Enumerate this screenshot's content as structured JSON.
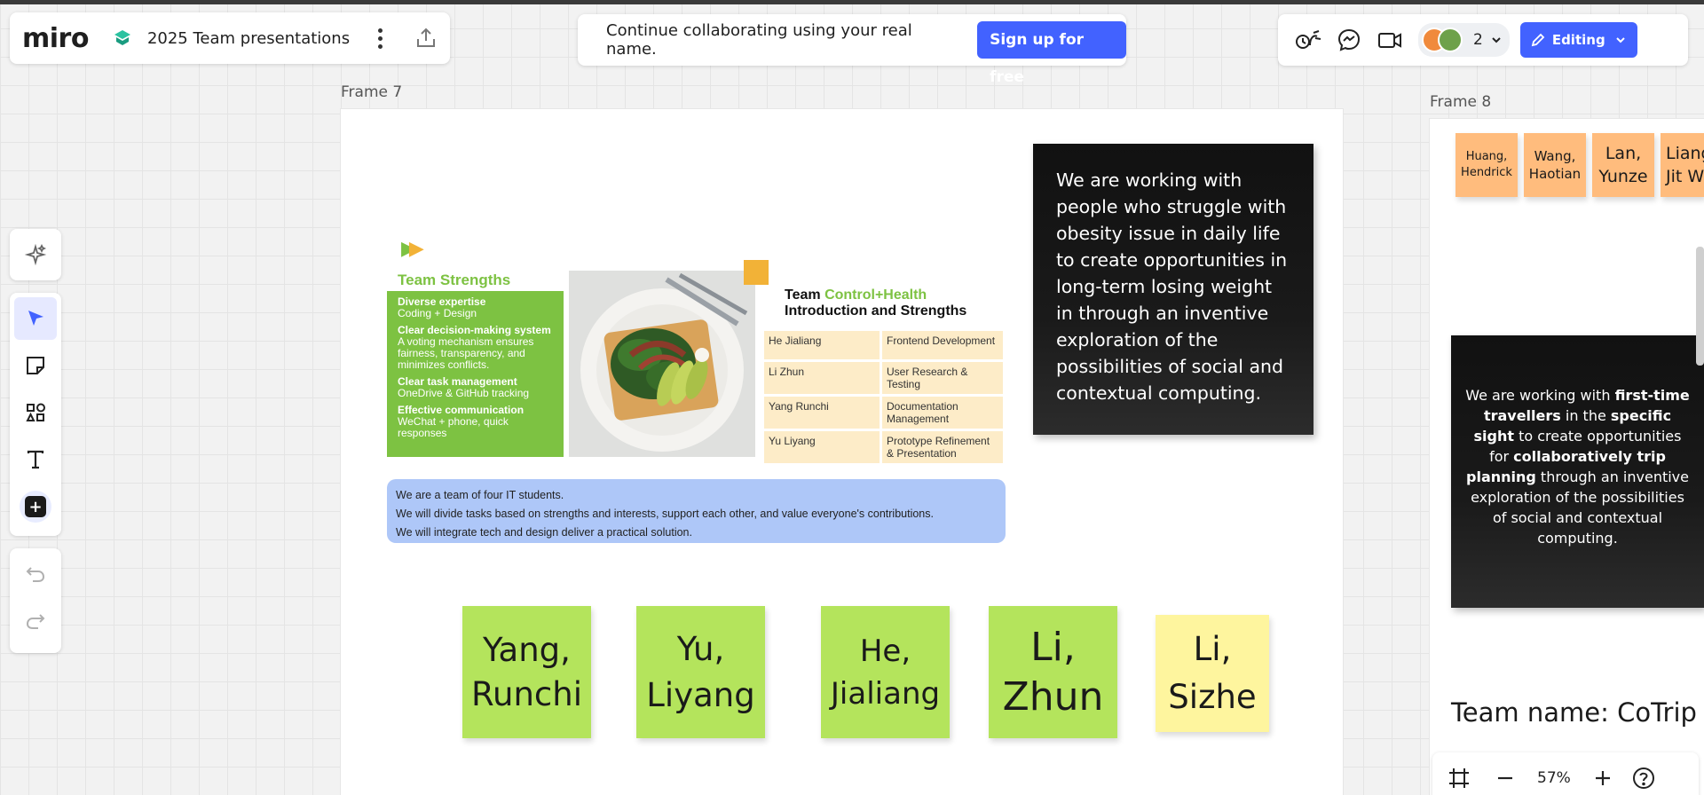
{
  "board": {
    "logo": "miro",
    "title": "2025 Team presentations"
  },
  "banner": {
    "text": "Continue collaborating using your real name.",
    "signup_label": "Sign up for free"
  },
  "collab": {
    "user_count": "2",
    "editing_label": "Editing"
  },
  "frames": {
    "frame7_label": "Frame 7",
    "frame8_label": "Frame 8"
  },
  "slide": {
    "strengths_title": "Team Strengths",
    "strengths": [
      {
        "heading": "Diverse expertise",
        "detail": "Coding + Design"
      },
      {
        "heading": "Clear decision-making system",
        "detail": "A voting mechanism ensures fairness, transparency, and minimizes conflicts."
      },
      {
        "heading": "Clear task management",
        "detail": "OneDrive & GitHub tracking"
      },
      {
        "heading": "Effective communication",
        "detail": "WeChat + phone, quick responses"
      }
    ],
    "intro_title_prefix": "Team ",
    "intro_title_highlight": "Control+Health",
    "intro_title_line2": "Introduction and Strengths",
    "roles": [
      {
        "name": "He Jialiang",
        "role": "Frontend Development"
      },
      {
        "name": "Li Zhun",
        "role": "User Research & Testing"
      },
      {
        "name": "Yang Runchi",
        "role": "Documentation Management"
      },
      {
        "name": "Yu Liyang",
        "role": "Prototype Refinement & Presentation"
      }
    ],
    "summary_lines": [
      "We are a team of four IT students.",
      "We will divide tasks based on strengths and interests, support each other, and value everyone's contributions.",
      "We will integrate tech and design deliver a practical solution."
    ]
  },
  "frame7_card": "We are working with people who struggle with obesity issue in daily life to create opportunities in long-term losing weight in through an inventive exploration of the possibilities of social and contextual computing.",
  "frame7_stickies": [
    {
      "line1": "Yang,",
      "line2": "Runchi",
      "color": "#b4e45c"
    },
    {
      "line1": "Yu,",
      "line2": "Liyang",
      "color": "#b4e45c"
    },
    {
      "line1": "He,",
      "line2": "Jialiang",
      "color": "#b4e45c"
    },
    {
      "line1": "Li,",
      "line2": "Zhun",
      "color": "#b4e45c"
    },
    {
      "line1": "Li,",
      "line2": "Sizhe",
      "color": "#fef59e"
    }
  ],
  "frame8_stickies": [
    {
      "line1": "Huang,",
      "line2": "Hendrick"
    },
    {
      "line1": "Wang,",
      "line2": "Haotian"
    },
    {
      "line1": "Lan,",
      "line2": "Yunze"
    },
    {
      "line1": "Liang",
      "line2": "Jit W"
    }
  ],
  "frame8_card": {
    "p1": "We are working with ",
    "b1": "first-time travellers",
    "p2": " in the ",
    "b2": "specific sight",
    "p3": " to create opportunities for ",
    "b3": "collaboratively trip planning",
    "p4": " through an inventive exploration of the possibilities of social and contextual computing."
  },
  "team_name": "Team name: CoTrip",
  "zoom": {
    "value": "57%"
  },
  "icons": [
    "board-icon",
    "more-icon",
    "share-icon",
    "reactions-icon",
    "comments-icon",
    "video-icon",
    "pencil-icon",
    "chevron-down-icon",
    "ai-sparkle-icon",
    "select-arrow-icon",
    "sticky-note-icon",
    "shapes-icon",
    "text-icon",
    "add-icon",
    "undo-icon",
    "redo-icon",
    "frame-icon",
    "zoom-out-icon",
    "zoom-in-icon",
    "help-icon"
  ]
}
